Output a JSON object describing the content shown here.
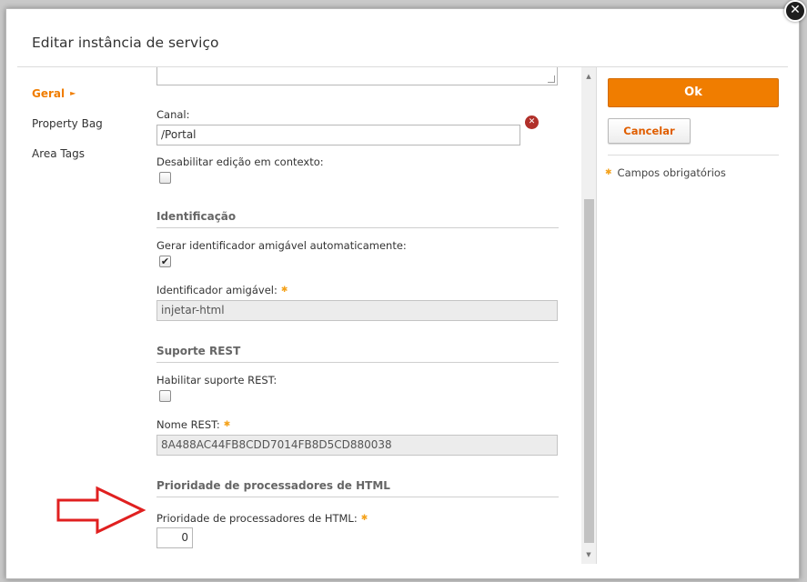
{
  "dialog": {
    "title": "Editar instância de serviço",
    "close_glyph": "✕"
  },
  "nav": {
    "items": [
      {
        "label": "Geral",
        "active": true
      },
      {
        "label": "Property Bag",
        "active": false
      },
      {
        "label": "Area Tags",
        "active": false
      }
    ],
    "active_arrow": "►"
  },
  "form": {
    "canal": {
      "label": "Canal:",
      "value": "/Portal"
    },
    "disable_context_edit": {
      "label": "Desabilitar edição em contexto:",
      "checked": false
    },
    "identificacao": {
      "section_title": "Identificação",
      "auto_id": {
        "label": "Gerar identificador amigável automaticamente:",
        "checked": true
      },
      "friendly_id": {
        "label": "Identificador amigável:",
        "value": "injetar-html",
        "required": true
      }
    },
    "rest": {
      "section_title": "Suporte REST",
      "enable": {
        "label": "Habilitar suporte REST:",
        "checked": false
      },
      "name": {
        "label": "Nome REST:",
        "value": "8A488AC44FB8CDD7014FB8D5CD880038",
        "required": true
      }
    },
    "html_processors": {
      "section_title": "Prioridade de processadores de HTML",
      "priority": {
        "label": "Prioridade de processadores de HTML:",
        "value": "0",
        "required": true
      }
    }
  },
  "actions": {
    "ok_label": "Ok",
    "cancel_label": "Cancelar"
  },
  "required_note": "Campos obrigatórios",
  "required_marker": "✱",
  "colors": {
    "accent": "#f07d00",
    "required": "#f4a21b",
    "clear_icon": "#b1302a",
    "annotation_arrow": "#e02020"
  }
}
